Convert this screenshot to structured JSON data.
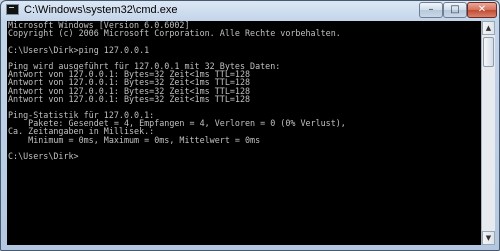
{
  "window": {
    "title": "C:\\Windows\\system32\\cmd.exe",
    "controls": {
      "minimize": "–",
      "maximize": "□",
      "close": "✕"
    }
  },
  "console": {
    "lines": [
      "Microsoft Windows [Version 6.0.6002]",
      "Copyright (c) 2006 Microsoft Corporation. Alle Rechte vorbehalten.",
      "",
      "C:\\Users\\Dirk>ping 127.0.0.1",
      "",
      "Ping wird ausgeführt für 127.0.0.1 mit 32 Bytes Daten:",
      "Antwort von 127.0.0.1: Bytes=32 Zeit<1ms TTL=128",
      "Antwort von 127.0.0.1: Bytes=32 Zeit<1ms TTL=128",
      "Antwort von 127.0.0.1: Bytes=32 Zeit<1ms TTL=128",
      "Antwort von 127.0.0.1: Bytes=32 Zeit<1ms TTL=128",
      "",
      "Ping-Statistik für 127.0.0.1:",
      "    Pakete: Gesendet = 4, Empfangen = 4, Verloren = 0 (0% Verlust),",
      "Ca. Zeitangaben in Millisek.:",
      "    Minimum = 0ms, Maximum = 0ms, Mittelwert = 0ms",
      "",
      "C:\\Users\\Dirk>"
    ]
  },
  "scrollbar": {
    "up": "▲",
    "down": "▼"
  }
}
